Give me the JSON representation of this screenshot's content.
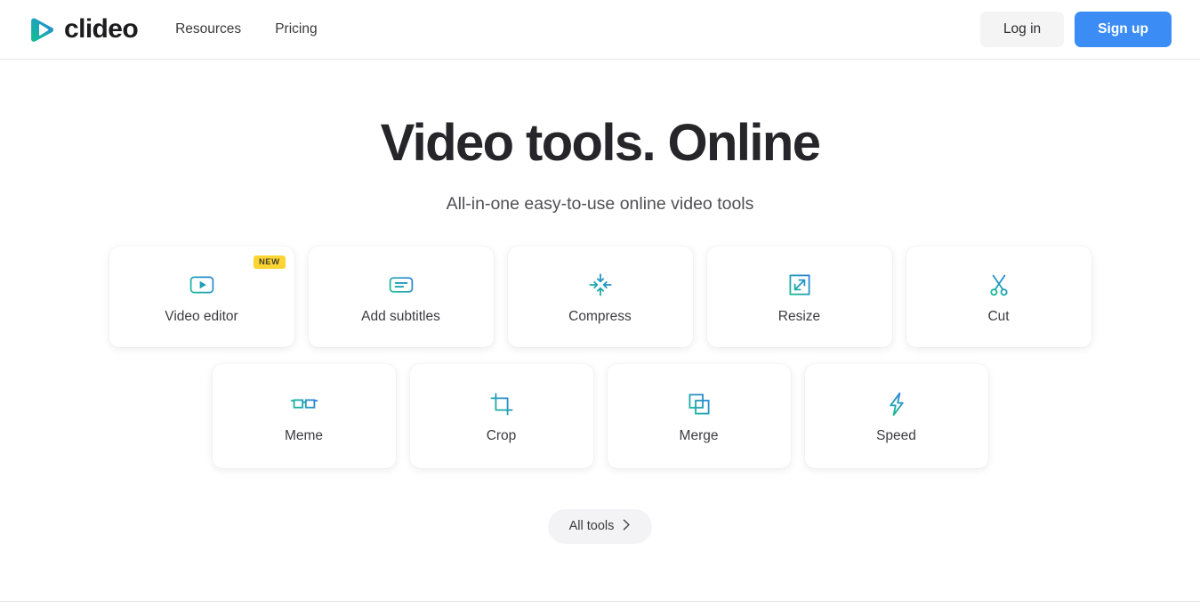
{
  "header": {
    "brand_name": "clideo",
    "logo_icon": "play-triangle-gradient-logo",
    "nav": [
      {
        "label": "Resources",
        "icon": ""
      },
      {
        "label": "Pricing",
        "icon": ""
      }
    ],
    "login_label": "Log in",
    "signup_label": "Sign up",
    "accent_blue": "#3b8cf5",
    "login_bg": "#f4f4f5"
  },
  "hero": {
    "title": "Video tools. Online",
    "subtitle": "All-in-one easy-to-use online video tools"
  },
  "tools": {
    "row1": [
      {
        "label": "Video editor",
        "icon": "video-editor-icon",
        "badge": "NEW"
      },
      {
        "label": "Add subtitles",
        "icon": "subtitles-icon",
        "badge": ""
      },
      {
        "label": "Compress",
        "icon": "compress-icon",
        "badge": ""
      },
      {
        "label": "Resize",
        "icon": "resize-icon",
        "badge": ""
      },
      {
        "label": "Cut",
        "icon": "scissors-icon",
        "badge": ""
      }
    ],
    "row2": [
      {
        "label": "Meme",
        "icon": "glasses-icon",
        "badge": ""
      },
      {
        "label": "Crop",
        "icon": "crop-icon",
        "badge": ""
      },
      {
        "label": "Merge",
        "icon": "merge-icon",
        "badge": ""
      },
      {
        "label": "Speed",
        "icon": "lightning-icon",
        "badge": ""
      }
    ],
    "icon_gradient_start": "#2a7de1",
    "icon_gradient_end": "#17bf8e",
    "badge_color": "#fdd533"
  },
  "footer_cta": {
    "all_tools_label": "All tools",
    "chevron_icon": "chevron-right-icon"
  }
}
